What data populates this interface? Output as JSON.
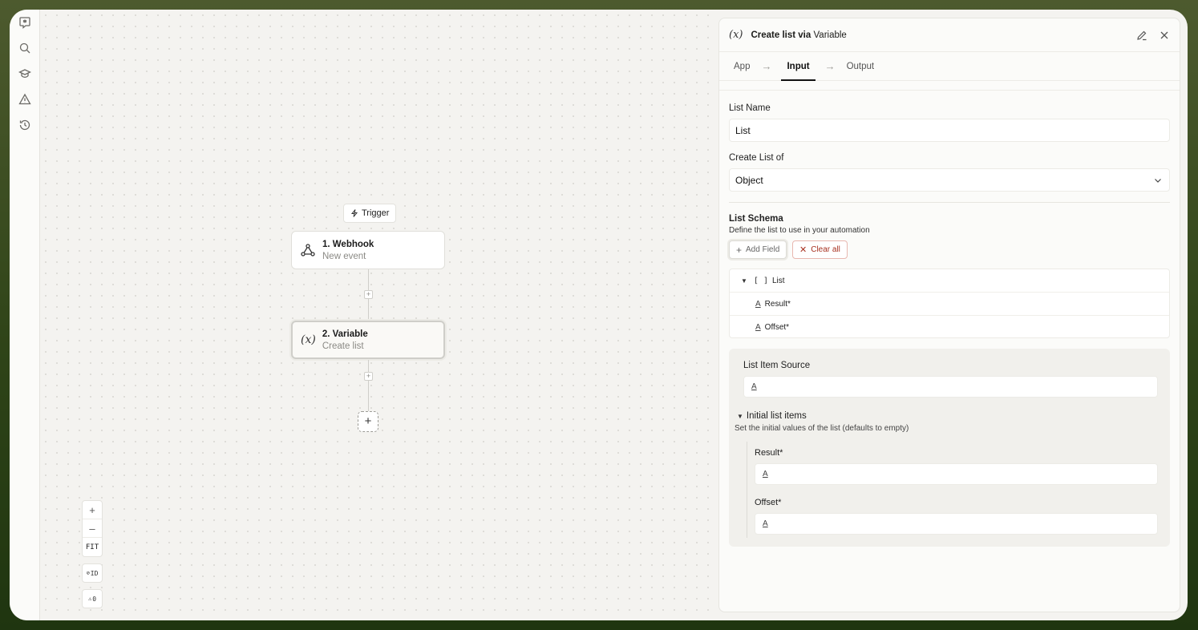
{
  "rail": {
    "icons": [
      "logo-icon",
      "search-icon",
      "graduation-cap-icon",
      "warning-icon",
      "history-icon"
    ]
  },
  "canvas": {
    "trigger_label": "Trigger",
    "nodes": [
      {
        "title": "1. Webhook",
        "subtitle": "New event",
        "icon": "webhook-icon"
      },
      {
        "title": "2. Variable",
        "subtitle": "Create list",
        "icon": "variable-icon"
      }
    ],
    "zoom": {
      "in": "+",
      "out": "–",
      "fit": "FIT"
    },
    "id_toggle": "ID",
    "warnings": "0"
  },
  "panel": {
    "icon_text": "(x)",
    "title_main": "Create list via",
    "title_app": "Variable",
    "tabs": [
      {
        "label": "App",
        "active": false
      },
      {
        "label": "Input",
        "active": true
      },
      {
        "label": "Output",
        "active": false
      }
    ],
    "list_name": {
      "label": "List Name",
      "value": "List"
    },
    "create_list_of": {
      "label": "Create List of",
      "value": "Object"
    },
    "schema": {
      "title": "List Schema",
      "subtitle": "Define the list to use in your automation",
      "add_field": "Add Field",
      "clear_all": "Clear all",
      "root": {
        "bracket": "[ ]",
        "label": "List"
      },
      "fields": [
        {
          "label": "Result*"
        },
        {
          "label": "Offset*"
        }
      ]
    },
    "source": {
      "label": "List Item Source",
      "placeholder_icon": "A",
      "initial_title": "Initial list items",
      "initial_sub": "Set the initial values of the list (defaults to empty)",
      "items": [
        {
          "label": "Result*",
          "icon": "A"
        },
        {
          "label": "Offset*",
          "icon": "A"
        }
      ]
    }
  }
}
